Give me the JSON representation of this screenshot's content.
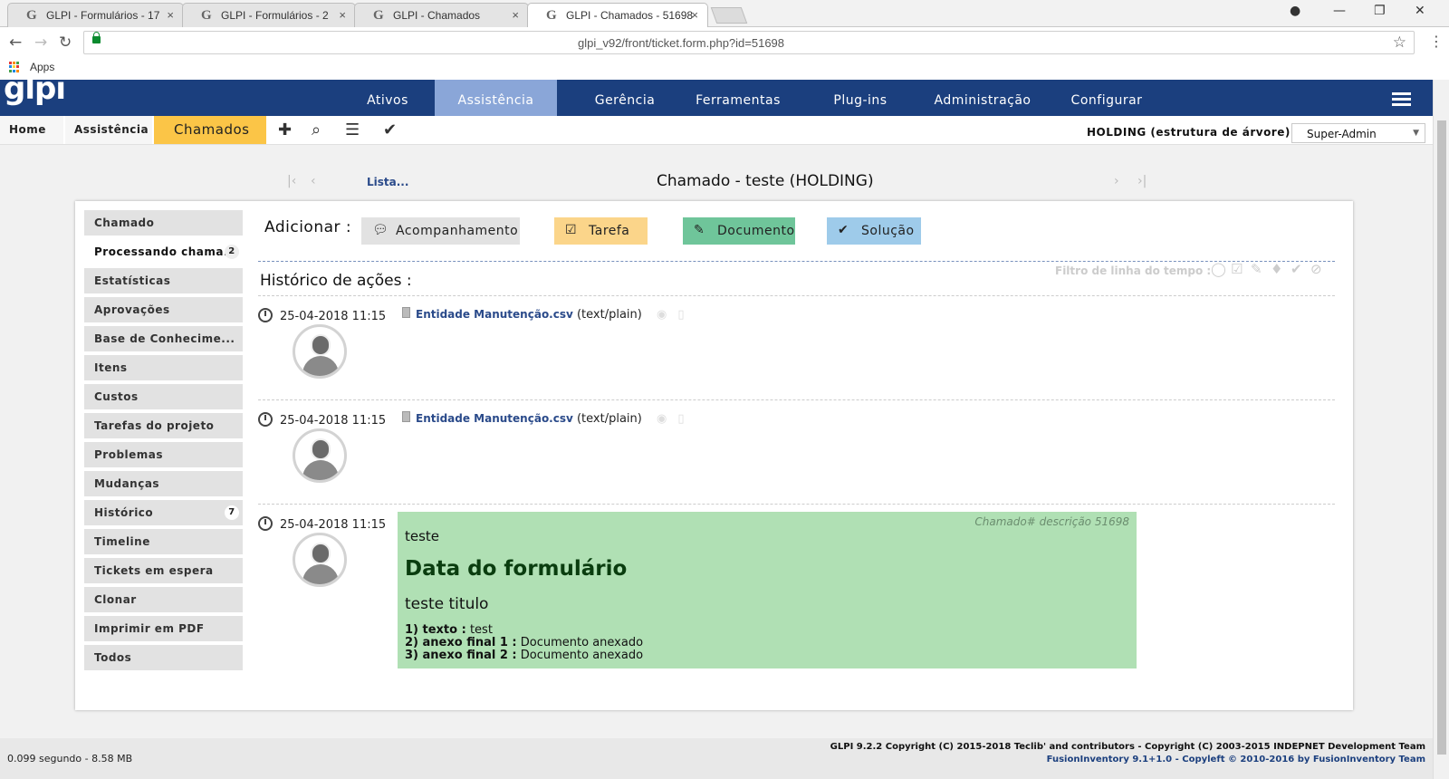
{
  "browser": {
    "tabs": [
      {
        "title": "GLPI - Formulários - 17",
        "close": "×"
      },
      {
        "title": "GLPI - Formulários - 2",
        "close": "×"
      },
      {
        "title": "GLPI - Chamados",
        "close": "×"
      },
      {
        "title": "GLPI - Chamados - 51698",
        "close": "×"
      }
    ],
    "favicon": "G",
    "url": "glpi_v92/front/ticket.form.php?id=51698",
    "bookmark_apps": "Apps",
    "apps_colors": [
      "#e53935",
      "#fb8c00",
      "#43a047",
      "#1e88e5",
      "#fdd835",
      "#e53935",
      "#43a047",
      "#1e88e5",
      "#fb8c00"
    ]
  },
  "glpi": {
    "logo": "glpi",
    "menu": [
      "Ativos",
      "Assistência",
      "Gerência",
      "Ferramentas",
      "Plug-ins",
      "Administração",
      "Configurar"
    ],
    "active_menu": "Assistência",
    "breadcrumbs": [
      "Home",
      "Assistência",
      "Chamados"
    ],
    "entity": "HOLDING (estrutura de árvore)",
    "profile": "Super-Admin"
  },
  "page": {
    "list_link": "Lista...",
    "title": "Chamado - teste (HOLDING)"
  },
  "sidebar": {
    "items": [
      {
        "label": "Chamado",
        "badge": ""
      },
      {
        "label": "Processando chama...",
        "badge": "2"
      },
      {
        "label": "Estatísticas",
        "badge": ""
      },
      {
        "label": "Aprovações",
        "badge": ""
      },
      {
        "label": "Base de Conhecime...",
        "badge": ""
      },
      {
        "label": "Itens",
        "badge": ""
      },
      {
        "label": "Custos",
        "badge": ""
      },
      {
        "label": "Tarefas do projeto",
        "badge": ""
      },
      {
        "label": "Problemas",
        "badge": ""
      },
      {
        "label": "Mudanças",
        "badge": ""
      },
      {
        "label": "Histórico",
        "badge": "7"
      },
      {
        "label": "Timeline",
        "badge": ""
      },
      {
        "label": "Tickets em espera",
        "badge": ""
      },
      {
        "label": "Clonar",
        "badge": ""
      },
      {
        "label": "Imprimir em PDF",
        "badge": ""
      },
      {
        "label": "Todos",
        "badge": ""
      }
    ],
    "active_index": 1
  },
  "actions": {
    "add_label": "Adicionar :",
    "followup": "Acompanhamento",
    "task": "Tarefa",
    "document": "Documento",
    "solution": "Solução",
    "colors": {
      "followup": "#e2e2e2",
      "task": "#fbd58a",
      "document": "#6fc59a",
      "solution": "#9ecbea"
    }
  },
  "timeline": {
    "history_title": "Histórico de ações :",
    "filter_label": "Filtro de linha do tempo :",
    "entries": [
      {
        "time": "25-04-2018 11:15",
        "doc_name": "Entidade Manutenção.csv",
        "doc_type": "(text/plain)"
      },
      {
        "time": "25-04-2018 11:15",
        "doc_name": "Entidade Manutenção.csv",
        "doc_type": "(text/plain)"
      },
      {
        "time": "25-04-2018 11:15"
      }
    ],
    "description": {
      "meta": "Chamado# descrição 51698",
      "text": "teste",
      "heading": "Data do formulário",
      "subheading": "teste titulo",
      "fields": [
        {
          "num": "1) texto :",
          "value": "test"
        },
        {
          "num": "2) anexo final 1 :",
          "value": "Documento anexado"
        },
        {
          "num": "3) anexo final 2 :",
          "value": "Documento anexado"
        }
      ]
    }
  },
  "footer": {
    "stats": "0.099 segundo - 8.58 MB",
    "copyright": "GLPI 9.2.2 Copyright (C) 2015-2018 Teclib' and contributors - Copyright (C) 2003-2015 INDEPNET Development Team",
    "fusion": "FusionInventory 9.1+1.0 - Copyleft © 2010-2016 by FusionInventory Team"
  }
}
